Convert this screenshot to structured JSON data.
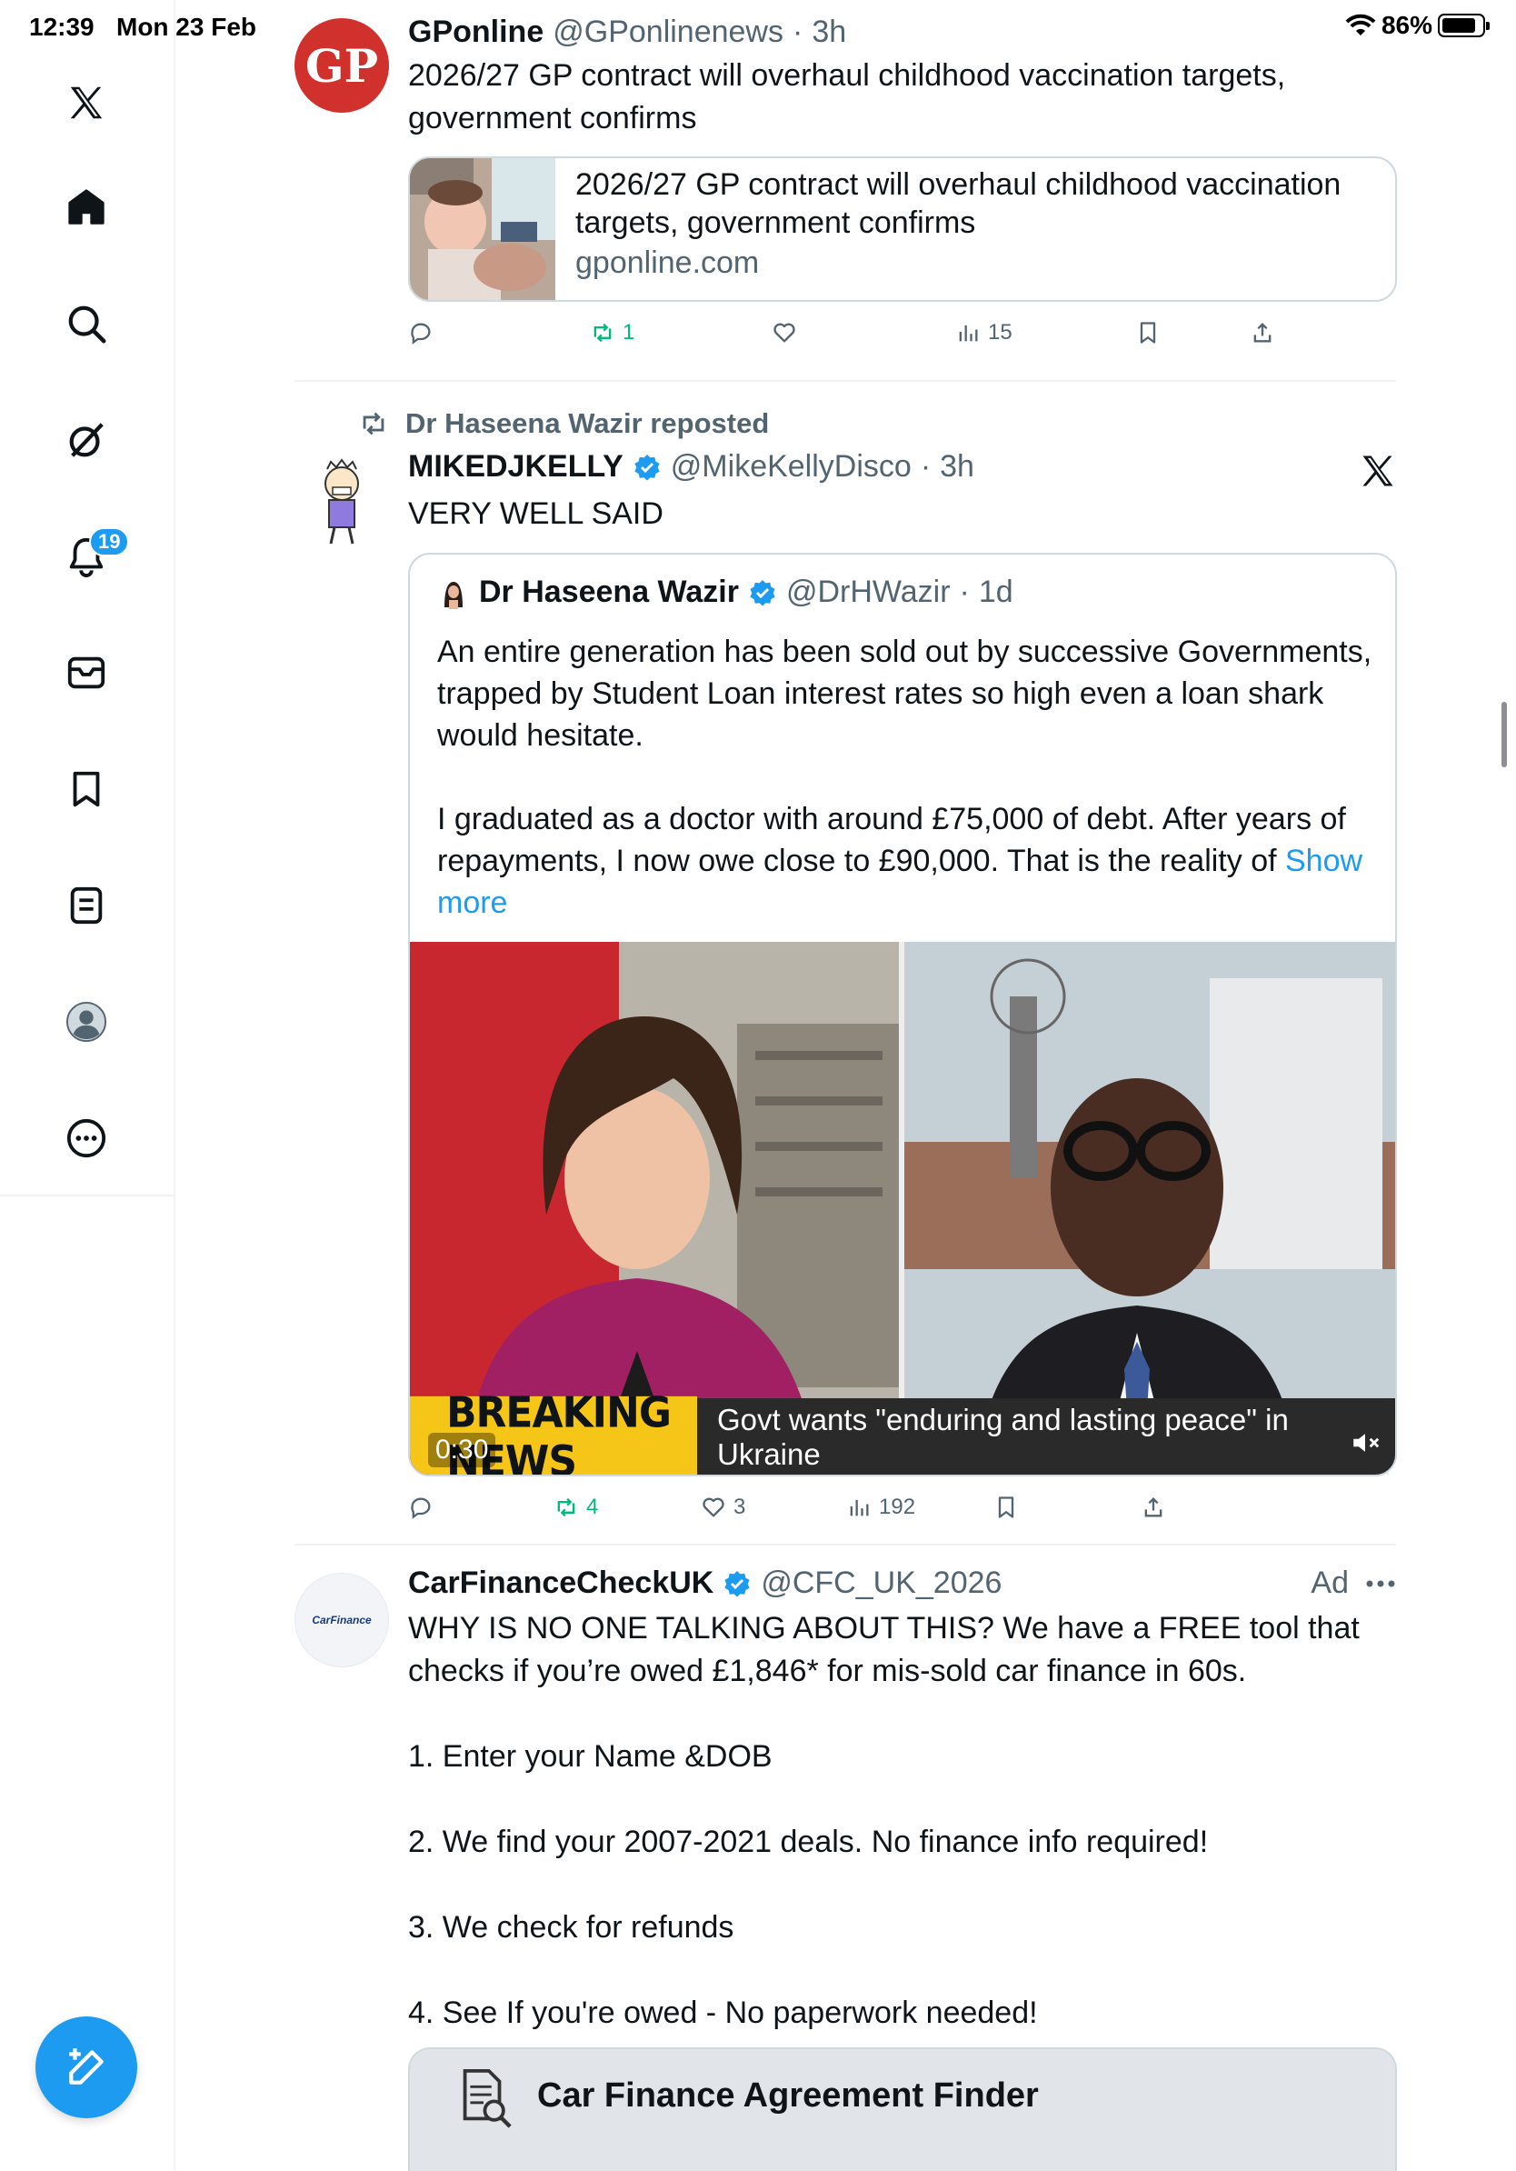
{
  "status_bar": {
    "time": "12:39",
    "date": "Mon 23 Feb",
    "battery": "86%"
  },
  "sidebar": {
    "items": [
      {
        "icon": "x-logo-icon"
      },
      {
        "icon": "home-icon"
      },
      {
        "icon": "search-icon"
      },
      {
        "icon": "grok-icon"
      },
      {
        "icon": "notifications-icon",
        "badge": "19"
      },
      {
        "icon": "messages-icon"
      },
      {
        "icon": "bookmarks-icon"
      },
      {
        "icon": "lists-icon"
      },
      {
        "icon": "profile-icon"
      },
      {
        "icon": "more-icon"
      }
    ],
    "compose_icon": "compose-icon"
  },
  "colors": {
    "accent": "#1d9bf0",
    "retweet": "#00ba7c",
    "muted": "#536471",
    "border": "#cfd9de"
  },
  "posts": [
    {
      "author": "GPonline",
      "handle": "@GPonlinenews",
      "time": "3h",
      "text": "2026/27 GP contract will overhaul childhood vaccination targets, government confirms",
      "avatar_text": "GP",
      "card": {
        "title": "2026/27 GP contract will overhaul childhood vaccination targets, government confirms",
        "domain": "gponline.com"
      },
      "stats": {
        "replies": "",
        "reposts": "1",
        "likes": "",
        "views": "15"
      }
    },
    {
      "reposted_by": "Dr Haseena Wazir reposted",
      "author": "MIKEDJKELLY",
      "handle": "@MikeKellyDisco",
      "time": "3h",
      "text": "VERY WELL SAID",
      "quote": {
        "author": "Dr Haseena Wazir",
        "handle": "@DrHWazir",
        "time": "1d",
        "text": "An entire generation has been sold out by successive Governments, trapped by Student Loan interest rates so high even a loan shark would hesitate.\n\nI graduated as a doctor with around £75,000 of debt. After years of repayments, I now owe close to £90,000. That is the reality of ",
        "show_more": "Show more",
        "video": {
          "ticker_label": "BREAKING NEWS",
          "ticker_text": "Govt wants \"enduring and lasting peace\" in Ukraine",
          "duration": "0:30"
        }
      },
      "stats": {
        "replies": "",
        "reposts": "4",
        "likes": "3",
        "views": "192"
      }
    },
    {
      "author": "CarFinanceCheckUK",
      "handle": "@CFC_UK_2026",
      "ad_label": "Ad",
      "avatar_text": "CarFinance",
      "text": "WHY IS NO ONE TALKING ABOUT THIS? We have a FREE tool that checks if you’re owed £1,846* for mis-sold car finance in 60s.\n\n1. Enter your Name &DOB\n\n2. We find your 2007-2021 deals. No finance info required!\n\n3. We check for refunds\n\n4. See If you're owed - No paperwork needed!",
      "card_title": "Car Finance Agreement Finder"
    }
  ]
}
